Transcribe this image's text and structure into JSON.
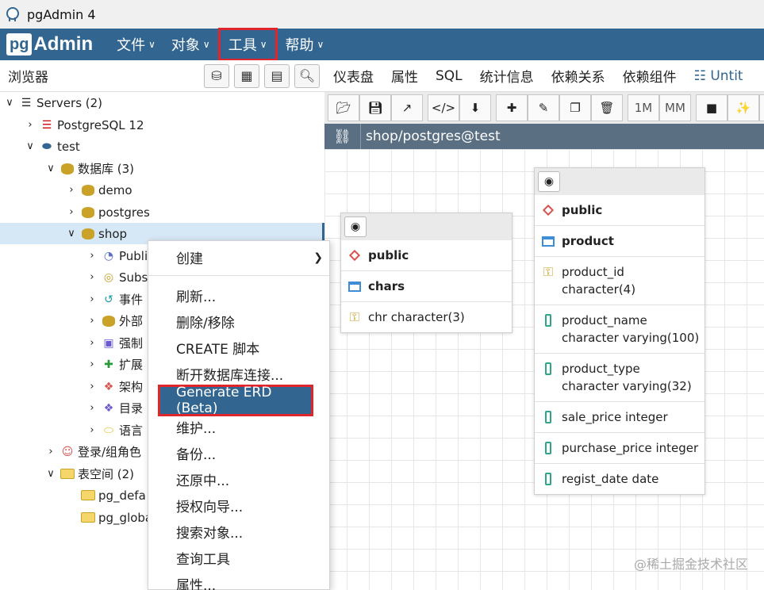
{
  "window": {
    "title": "pgAdmin 4"
  },
  "menubar": {
    "brand_pg": "pg",
    "brand_admin": "Admin",
    "items": [
      {
        "label": "文件"
      },
      {
        "label": "对象"
      },
      {
        "label": "工具"
      },
      {
        "label": "帮助"
      }
    ]
  },
  "browser": {
    "title": "浏览器",
    "tree": [
      {
        "label": "Servers (2)"
      },
      {
        "label": "PostgreSQL 12"
      },
      {
        "label": "test"
      },
      {
        "label": "数据库 (3)"
      },
      {
        "label": "demo"
      },
      {
        "label": "postgres"
      },
      {
        "label": "shop"
      },
      {
        "label": "Publi"
      },
      {
        "label": "Subs"
      },
      {
        "label": "事件"
      },
      {
        "label": "外部"
      },
      {
        "label": "强制"
      },
      {
        "label": "扩展"
      },
      {
        "label": "架构"
      },
      {
        "label": "目录"
      },
      {
        "label": "语言"
      },
      {
        "label": "登录/组角色"
      },
      {
        "label": "表空间 (2)"
      },
      {
        "label": "pg_defa"
      },
      {
        "label": "pg_globa"
      }
    ]
  },
  "context_menu": {
    "items": [
      {
        "label": "创建"
      },
      {
        "label": "刷新..."
      },
      {
        "label": "删除/移除"
      },
      {
        "label": "CREATE 脚本"
      },
      {
        "label": "断开数据库连接..."
      },
      {
        "label": "Generate ERD (Beta)"
      },
      {
        "label": "维护..."
      },
      {
        "label": "备份..."
      },
      {
        "label": "还原中..."
      },
      {
        "label": "授权向导..."
      },
      {
        "label": "搜索对象..."
      },
      {
        "label": "查询工具"
      },
      {
        "label": "属性..."
      }
    ]
  },
  "tabs": [
    {
      "label": "仪表盘"
    },
    {
      "label": "属性"
    },
    {
      "label": "SQL"
    },
    {
      "label": "统计信息"
    },
    {
      "label": "依赖关系"
    },
    {
      "label": "依赖组件"
    },
    {
      "label": "Untit"
    }
  ],
  "erd_toolbar": {
    "one_to_many": "1M",
    "many_to_many": "MM"
  },
  "connection": {
    "label": "shop/postgres@test"
  },
  "erd": {
    "chars": {
      "schema": "public",
      "table": "chars",
      "columns": [
        "chr character(3)"
      ]
    },
    "product": {
      "schema": "public",
      "table": "product",
      "columns": [
        "product_id character(4)",
        "product_name character varying(100)",
        "product_type character varying(32)",
        "sale_price integer",
        "purchase_price integer",
        "regist_date date"
      ]
    }
  },
  "watermark": "@稀土掘金技术社区",
  "colors": {
    "menubar": "#326690",
    "highlight_border": "#e0262d",
    "connbar": "#5b6f82"
  }
}
